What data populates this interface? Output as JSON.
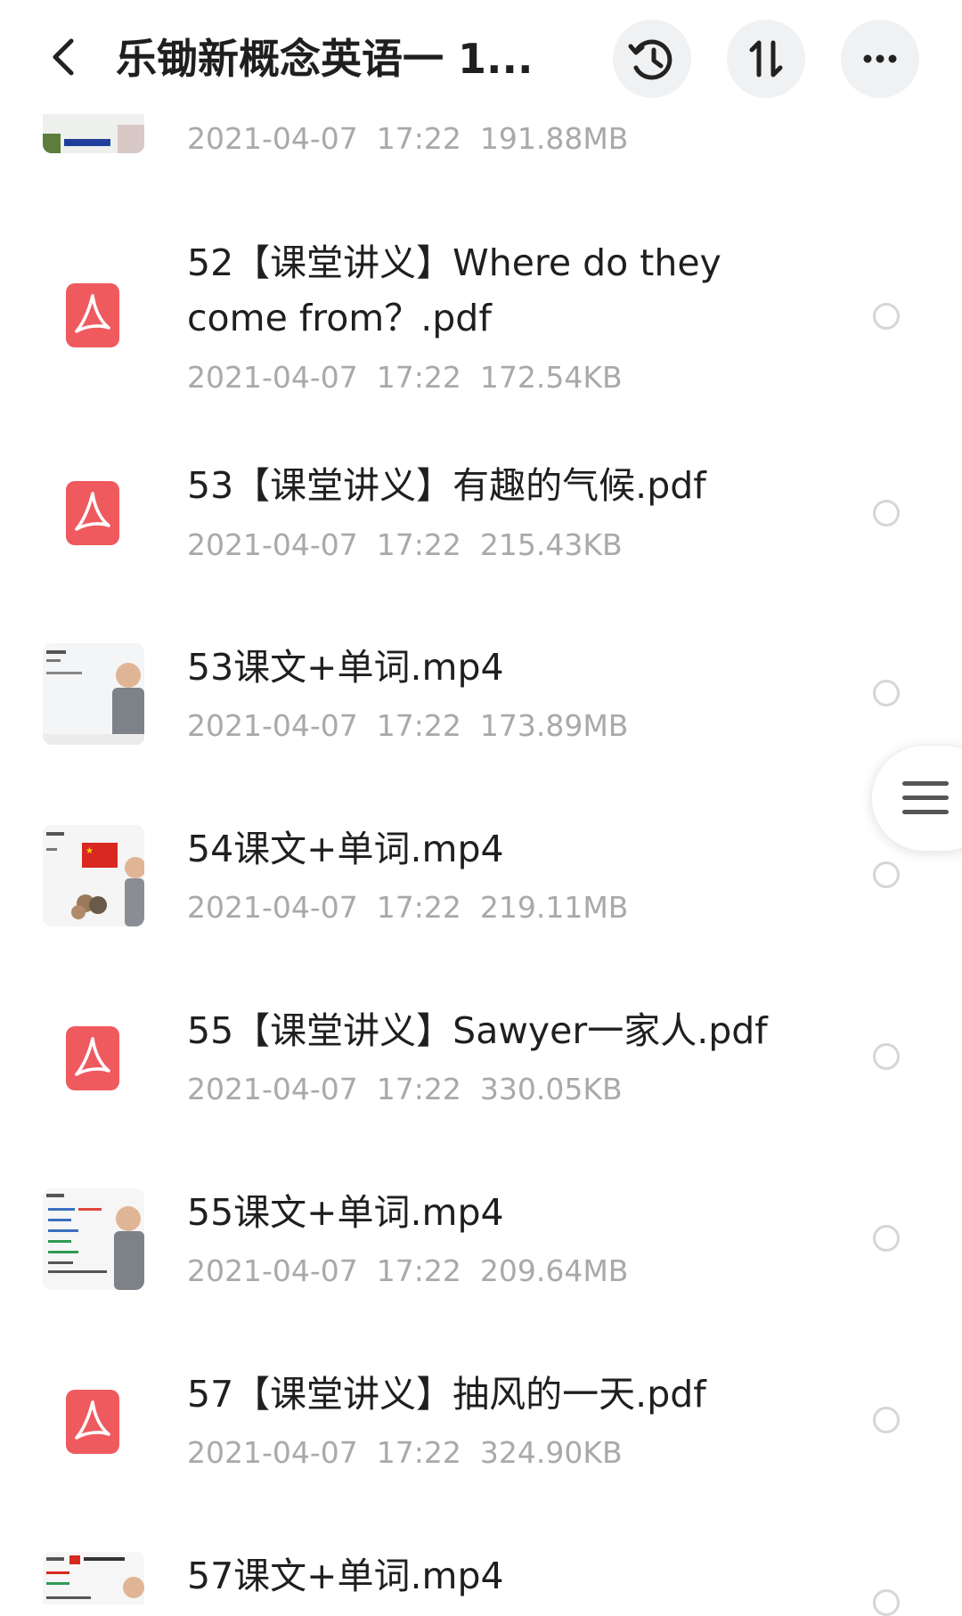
{
  "header": {
    "title": "乐锄新概念英语一 1...",
    "buttons": [
      "back-icon",
      "history-icon",
      "sort-icon",
      "more-icon"
    ]
  },
  "files": [
    {
      "name": "",
      "date": "2021-04-07",
      "time": "17:22",
      "size": "191.88MB",
      "type": "video"
    },
    {
      "name": "52【课堂讲义】Where do they come from？.pdf",
      "date": "2021-04-07",
      "time": "17:22",
      "size": "172.54KB",
      "type": "pdf"
    },
    {
      "name": "53【课堂讲义】有趣的气候.pdf",
      "date": "2021-04-07",
      "time": "17:22",
      "size": "215.43KB",
      "type": "pdf"
    },
    {
      "name": "53课文+单词.mp4",
      "date": "2021-04-07",
      "time": "17:22",
      "size": "173.89MB",
      "type": "video"
    },
    {
      "name": "54课文+单词.mp4",
      "date": "2021-04-07",
      "time": "17:22",
      "size": "219.11MB",
      "type": "video"
    },
    {
      "name": "55【课堂讲义】Sawyer一家人.pdf",
      "date": "2021-04-07",
      "time": "17:22",
      "size": "330.05KB",
      "type": "pdf"
    },
    {
      "name": "55课文+单词.mp4",
      "date": "2021-04-07",
      "time": "17:22",
      "size": "209.64MB",
      "type": "video"
    },
    {
      "name": "57【课堂讲义】抽风的一天.pdf",
      "date": "2021-04-07",
      "time": "17:22",
      "size": "324.90KB",
      "type": "pdf"
    },
    {
      "name": "57课文+单词.mp4",
      "date": "",
      "time": "",
      "size": "",
      "type": "video"
    }
  ],
  "colors": {
    "pdf": "#ef5a5f",
    "meta": "#a9a9a9",
    "radio_border": "#d6d6d6"
  }
}
